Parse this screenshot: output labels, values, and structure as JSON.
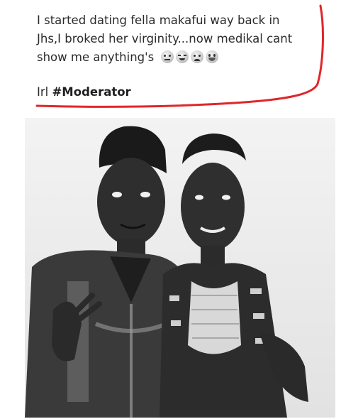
{
  "post": {
    "lines": [
      "I started dating fella makafui way back in",
      "Jhs,I broked her virginity...now medikal cant",
      "show me anything's"
    ],
    "emojis": [
      "expressionless-face-icon",
      "relieved-face-icon",
      "crying-face-icon",
      "grinning-face-icon"
    ],
    "tag_prefix": "Irl",
    "hashtag": "#Moderator"
  },
  "annotation": {
    "color": "#e0262a"
  },
  "photo": {
    "subject": "photo"
  }
}
